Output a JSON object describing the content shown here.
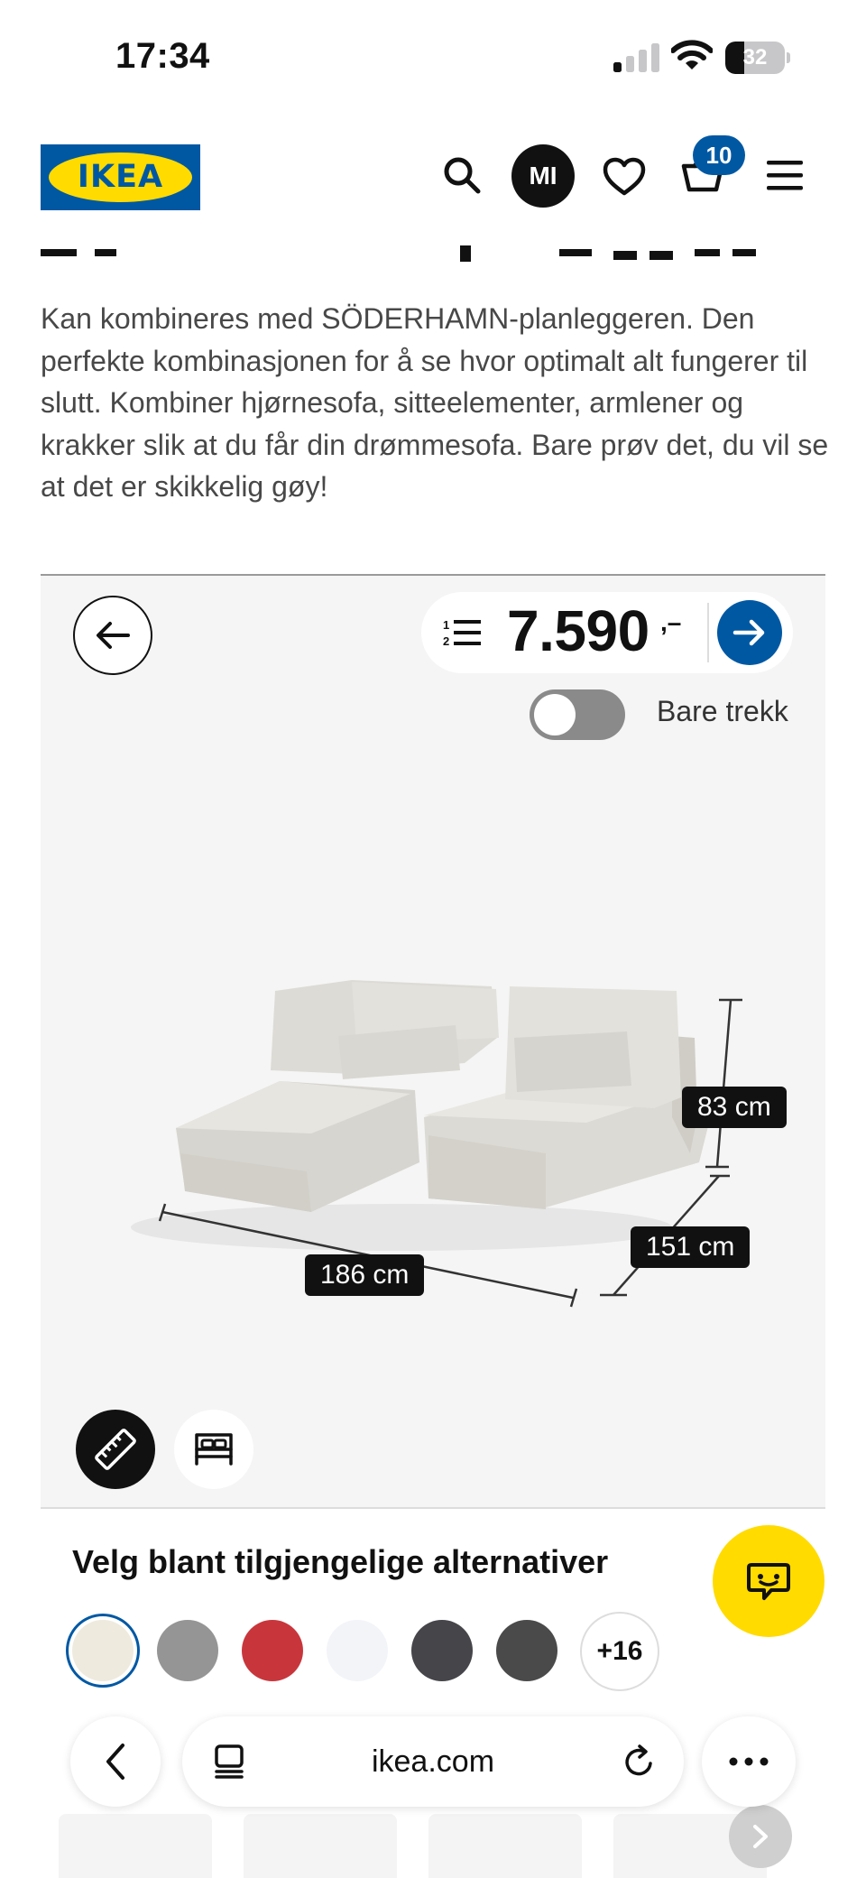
{
  "status_bar": {
    "time": "17:34",
    "battery": "32",
    "battery_level": 0.32
  },
  "header": {
    "logo_text": "IKEA",
    "avatar_initials": "MI",
    "cart_count": "10"
  },
  "product": {
    "description": "Kan kombineres med SÖDERHAMN-planleggeren. Den perfekte kombinasjonen for å se hvor optimalt alt fungerer til slutt. Kombiner hjørnesofa, sitteelementer, armlener og krakker slik at du får din drømmesofa. Bare prøv det, du vil se at det er skikkelig gøy!"
  },
  "planner": {
    "price": "7.590",
    "price_suffix": ",–",
    "toggle_label": "Bare trekk",
    "toggle_on": false,
    "dimensions": {
      "height": "83 cm",
      "depth": "151 cm",
      "width": "186 cm"
    }
  },
  "alternatives": {
    "title": "Velg blant tilgjengelige alternativer",
    "more_label": "+16",
    "swatches": [
      {
        "color": "#eeeade",
        "selected": true
      },
      {
        "color": "#959595",
        "selected": false
      },
      {
        "color": "#c8363c",
        "selected": false
      },
      {
        "color": "#f3f4f8",
        "selected": false
      },
      {
        "color": "#45454a",
        "selected": false
      },
      {
        "color": "#4a4a4a",
        "selected": false
      }
    ]
  },
  "browser": {
    "url": "ikea.com"
  },
  "colors": {
    "brand_blue": "#0058a3",
    "brand_yellow": "#ffdb00"
  }
}
